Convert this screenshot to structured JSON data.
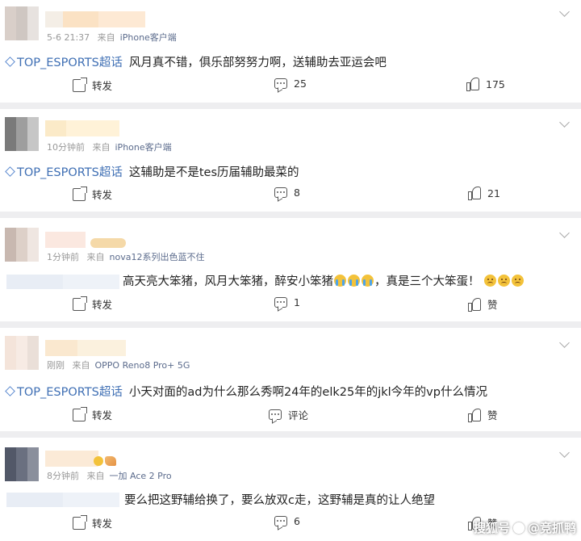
{
  "posts": [
    {
      "time": "5-6 21:37",
      "source": "来自",
      "device": "iPhone客户端",
      "topic": "TOP_ESPORTS超话",
      "text": "风月真不错，俱乐部努努力啊，送辅助去亚运会吧",
      "share_label": "转发",
      "comment_count": "25",
      "like_count": "175"
    },
    {
      "time": "10分钟前",
      "source": "来自",
      "device": "iPhone客户端",
      "topic": "TOP_ESPORTS超话",
      "text": "这辅助是不是tes历届辅助最菜的",
      "share_label": "转发",
      "comment_count": "8",
      "like_count": "21"
    },
    {
      "time": "1分钟前",
      "source": "来自",
      "device": "nova12系列出色蓝不住",
      "topic": "",
      "text_a": "高天亮大笨猪，风月大笨猪，醉安小笨猪",
      "text_b": "，真是三个大笨蛋！",
      "share_label": "转发",
      "comment_count": "1",
      "like_count": "赞"
    },
    {
      "time": "刚刚",
      "source": "来自",
      "device": "OPPO Reno8 Pro+ 5G",
      "topic": "TOP_ESPORTS超话",
      "text": "小天对面的ad为什么那么秀啊24年的elk25年的jkl今年的vp什么情况",
      "share_label": "转发",
      "comment_count": "评论",
      "like_count": "赞"
    },
    {
      "time": "8分钟前",
      "source": "来自",
      "device": "一加 Ace 2 Pro",
      "topic": "",
      "text": "要么把这野辅给换了，要么放双c走，这野辅是真的让人绝望",
      "share_label": "转发",
      "comment_count": "6",
      "like_count": "赞"
    }
  ],
  "watermark": {
    "brand": "搜狐号",
    "account": "@竞抓鸭"
  },
  "colors": {
    "topic": "#3f6fb4",
    "device": "#5b6b8c",
    "background": "#eeeef0"
  },
  "icons": [
    "diamond-icon",
    "share-icon",
    "comment-icon",
    "like-icon",
    "chevron-down-icon",
    "sohu-paw-icon"
  ]
}
